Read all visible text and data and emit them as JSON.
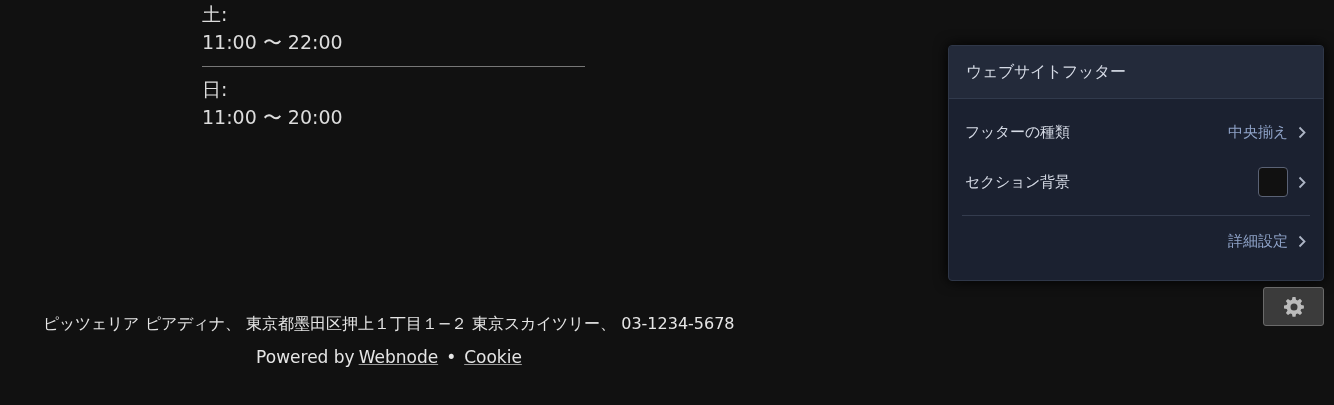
{
  "hours": [
    {
      "day": "土:",
      "time": "11:00 〜 22:00"
    },
    {
      "day": "日:",
      "time": "11:00 〜 20:00"
    }
  ],
  "footer": {
    "address": "ピッツェリア ピアディナ、 東京都墨田区押上１丁目１−２ 東京スカイツリー、 03-1234-5678",
    "powered_by": "Powered by",
    "powered_link": "Webnode",
    "separator": "•",
    "cookie_link": "Cookie"
  },
  "panel": {
    "title": "ウェブサイトフッター",
    "rows": [
      {
        "kind": "value",
        "label": "フッターの種類",
        "value": "中央揃え"
      },
      {
        "kind": "swatch",
        "label": "セクション背景",
        "color": "#111111"
      }
    ],
    "advanced": "詳細設定"
  }
}
